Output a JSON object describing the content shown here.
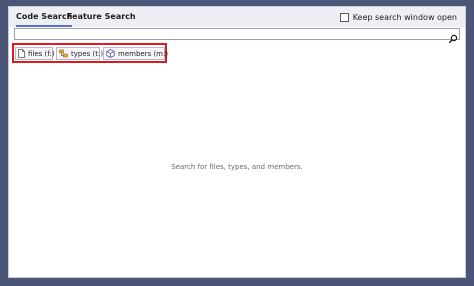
{
  "tabs": [
    {
      "label": "Code Search",
      "active": true
    },
    {
      "label": "Feature Search",
      "active": false
    }
  ],
  "keep_open": {
    "label": "Keep search window open",
    "checked": false
  },
  "search": {
    "value": "",
    "placeholder": ""
  },
  "filters": [
    {
      "label": "files (f:)",
      "icon": "file-icon"
    },
    {
      "label": "types (t:)",
      "icon": "types-icon"
    },
    {
      "label": "members (m:)",
      "icon": "cube-icon"
    }
  ],
  "empty_hint": "Search for files, types, and members.",
  "colors": {
    "highlight": "#e01a22",
    "tab_underline": "#5a6fd4",
    "background": "#4a5578"
  }
}
